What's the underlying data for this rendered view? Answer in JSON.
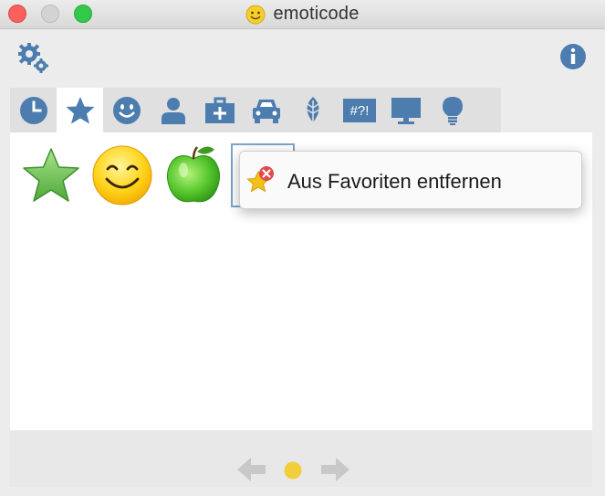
{
  "window": {
    "title": "emoticode",
    "title_icon": "smiley-icon"
  },
  "toolbar": {
    "settings_icon": "gear-icon",
    "info_icon": "info-icon"
  },
  "tabs": [
    {
      "id": "recent",
      "icon": "clock-icon",
      "active": false
    },
    {
      "id": "favorites",
      "icon": "star-icon",
      "active": true
    },
    {
      "id": "smileys",
      "icon": "smiley-face-icon",
      "active": false
    },
    {
      "id": "people",
      "icon": "person-icon",
      "active": false
    },
    {
      "id": "objects",
      "icon": "toolbox-icon",
      "active": false
    },
    {
      "id": "travel",
      "icon": "car-icon",
      "active": false
    },
    {
      "id": "nature",
      "icon": "leaf-icon",
      "active": false
    },
    {
      "id": "symbols",
      "icon": "symbols-icon",
      "label": "#?!",
      "active": false
    },
    {
      "id": "technology",
      "icon": "monitor-icon",
      "active": false
    },
    {
      "id": "ideas",
      "icon": "lightbulb-icon",
      "active": false
    }
  ],
  "favorites": [
    {
      "name": "green-star",
      "icon": "green-star-emoji"
    },
    {
      "name": "smiling-face",
      "icon": "smiling-face-emoji"
    },
    {
      "name": "green-apple",
      "icon": "green-apple-emoji"
    },
    {
      "name": "selected-emoji",
      "icon": "yellow-emoji",
      "selected": true
    }
  ],
  "context_menu": {
    "items": [
      {
        "label": "Aus Favoriten entfernen",
        "icon": "remove-favorite-icon"
      }
    ]
  },
  "pagination": {
    "prev_icon": "arrow-left-icon",
    "next_icon": "arrow-right-icon",
    "current_page": 1,
    "page_count": 1
  },
  "colors": {
    "tab_icon": "#4d7cae",
    "page_dot": "#f2cf3a",
    "nav_arrow": "#c8c8c8"
  }
}
